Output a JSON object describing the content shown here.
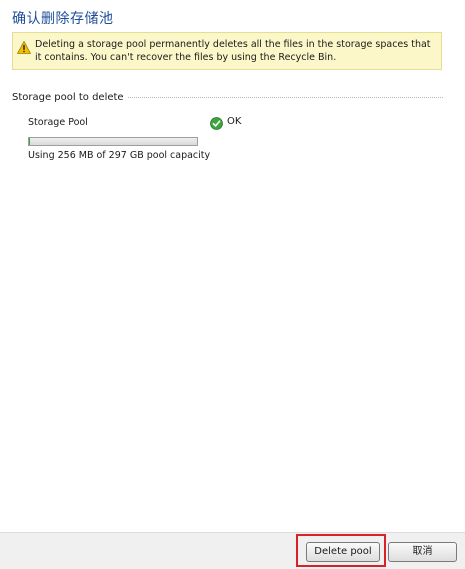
{
  "dialog": {
    "title": "确认删除存储池",
    "warning": {
      "icon": "warning-icon",
      "text": "Deleting a storage pool permanently deletes all the files in the storage spaces that it contains. You can't recover the files by using the Recycle Bin."
    },
    "section": {
      "label": "Storage pool to delete"
    },
    "pool": {
      "name": "Storage Pool",
      "status_icon": "check-circle-icon",
      "status": "OK",
      "capacity_used_fraction": 0.0008,
      "capacity_text": "Using 256 MB of 297 GB pool capacity"
    },
    "buttons": {
      "delete_label": "Delete pool",
      "cancel_label": "取消"
    },
    "colors": {
      "title": "#1f4e99",
      "warning_bg": "#fbf7c9",
      "ok_green": "#3ca43c",
      "highlight": "#d8222a"
    }
  }
}
